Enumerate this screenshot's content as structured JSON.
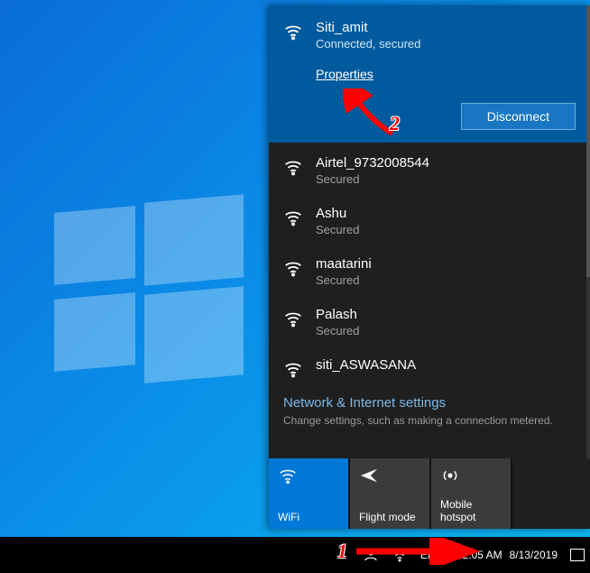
{
  "connected": {
    "name": "Siti_amit",
    "status": "Connected, secured",
    "properties_label": "Properties",
    "disconnect_label": "Disconnect"
  },
  "networks": [
    {
      "name": "Airtel_9732008544",
      "status": "Secured"
    },
    {
      "name": "Ashu",
      "status": "Secured"
    },
    {
      "name": "maatarini",
      "status": "Secured"
    },
    {
      "name": "Palash",
      "status": "Secured"
    },
    {
      "name": "siti_ASWASANA",
      "status": ""
    }
  ],
  "settings": {
    "title": "Network & Internet settings",
    "subtitle": "Change settings, such as making a connection metered."
  },
  "tiles": {
    "wifi": "WiFi",
    "flight": "Flight mode",
    "hotspot": "Mobile hotspot"
  },
  "tray": {
    "lang": "ENG",
    "time": "12:05 AM",
    "date": "8/13/2019"
  },
  "annotations": {
    "num1": "1",
    "num2": "2"
  }
}
